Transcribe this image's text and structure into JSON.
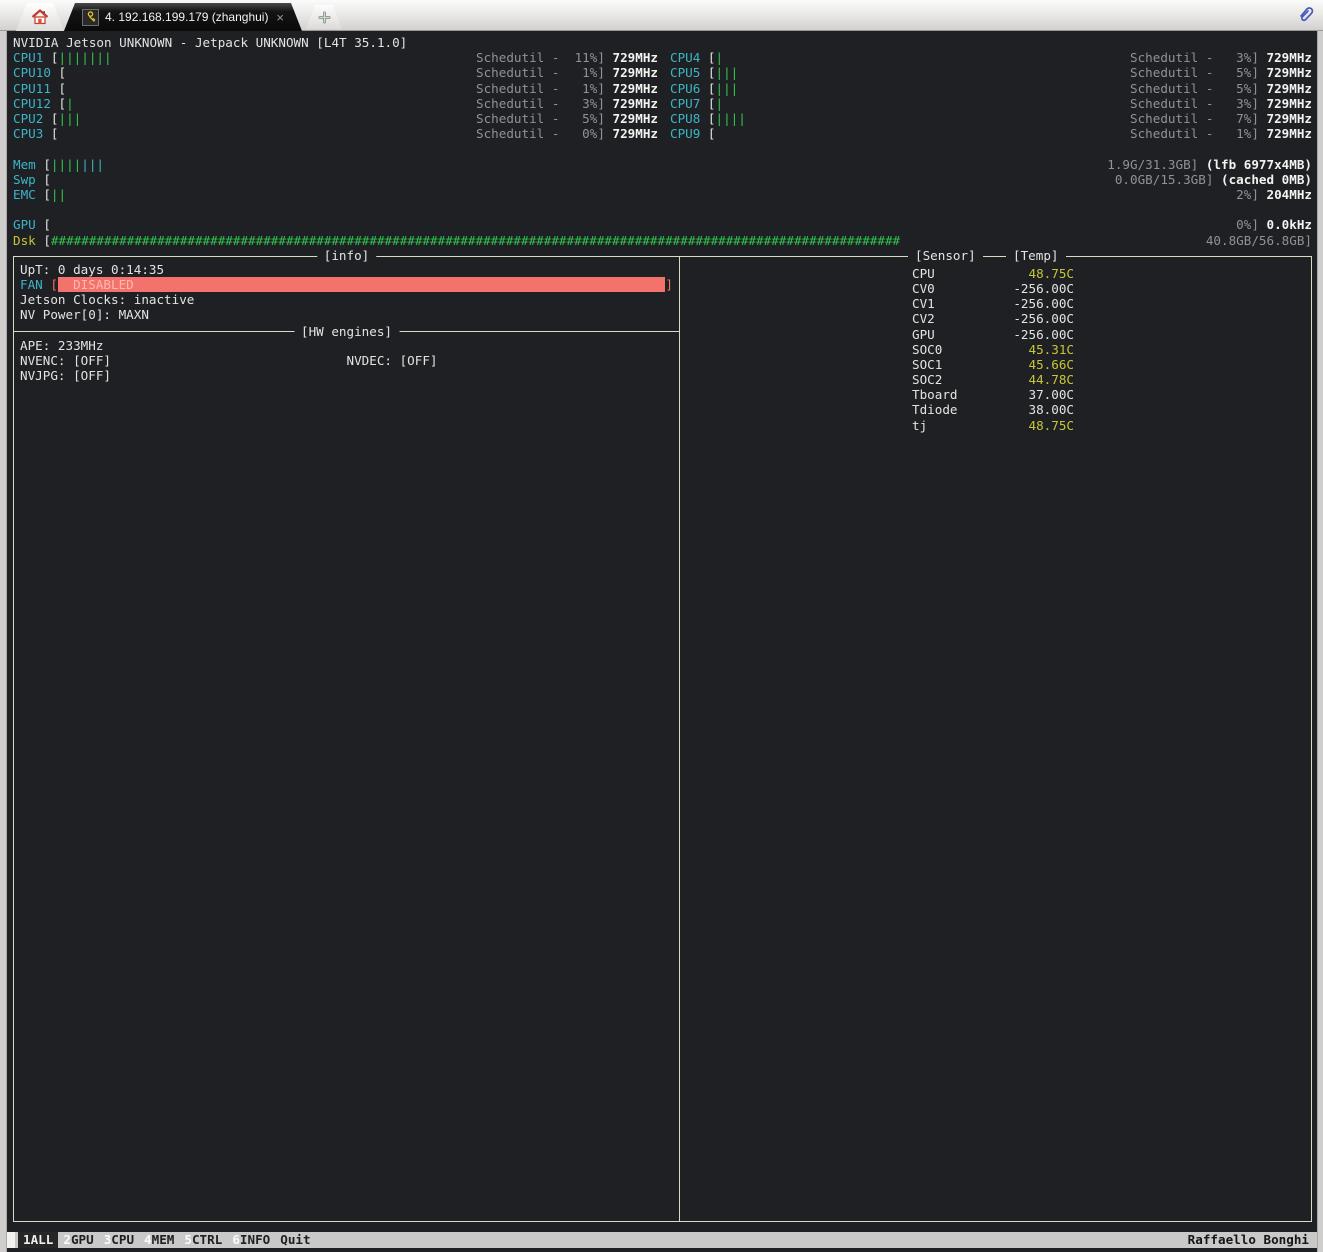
{
  "tab_bar": {
    "home_tab": {
      "icon": "home-icon"
    },
    "session_tab": {
      "icon": "key-icon",
      "title": "4. 192.168.199.179 (zhanghui)",
      "close": "×"
    },
    "new_tab": "+",
    "pin_icon": "paperclip-icon"
  },
  "terminal": {
    "title_line": "NVIDIA Jetson UNKNOWN - Jetpack UNKNOWN [L4T 35.1.0]",
    "cpu_left": [
      {
        "label": "CPU1",
        "bars": 7,
        "governor": "Schedutil",
        "percent": 11,
        "freq": "729MHz"
      },
      {
        "label": "CPU10",
        "bars": 0,
        "governor": "Schedutil",
        "percent": 1,
        "freq": "729MHz"
      },
      {
        "label": "CPU11",
        "bars": 0,
        "governor": "Schedutil",
        "percent": 1,
        "freq": "729MHz"
      },
      {
        "label": "CPU12",
        "bars": 1,
        "governor": "Schedutil",
        "percent": 3,
        "freq": "729MHz"
      },
      {
        "label": "CPU2",
        "bars": 3,
        "governor": "Schedutil",
        "percent": 5,
        "freq": "729MHz"
      },
      {
        "label": "CPU3",
        "bars": 0,
        "governor": "Schedutil",
        "percent": 0,
        "freq": "729MHz"
      }
    ],
    "cpu_right": [
      {
        "label": "CPU4",
        "bars": 1,
        "governor": "Schedutil",
        "percent": 3,
        "freq": "729MHz"
      },
      {
        "label": "CPU5",
        "bars": 3,
        "governor": "Schedutil",
        "percent": 5,
        "freq": "729MHz"
      },
      {
        "label": "CPU6",
        "bars": 3,
        "governor": "Schedutil",
        "percent": 5,
        "freq": "729MHz"
      },
      {
        "label": "CPU7",
        "bars": 1,
        "governor": "Schedutil",
        "percent": 3,
        "freq": "729MHz"
      },
      {
        "label": "CPU8",
        "bars": 4,
        "governor": "Schedutil",
        "percent": 7,
        "freq": "729MHz"
      },
      {
        "label": "CPU9",
        "bars": 0,
        "governor": "Schedutil",
        "percent": 1,
        "freq": "729MHz"
      }
    ],
    "mem_gauges": [
      {
        "label": "Mem",
        "bars_used": 4,
        "bars_cached": 3,
        "right": "1.9G/31.3GB]",
        "extra": "(lfb 6977x4MB)"
      },
      {
        "label": "Swp",
        "bars_used": 0,
        "bars_cached": 0,
        "right": "0.0GB/15.3GB]",
        "extra": "(cached 0MB)"
      },
      {
        "label": "EMC",
        "bars_used": 2,
        "bars_cached": 0,
        "right": "2%]",
        "extra": "204MHz"
      }
    ],
    "gpu_gauge": {
      "label": "GPU",
      "bars_used": 0,
      "bars_cached": 0,
      "right": "0%]",
      "extra": "0.0kHz"
    },
    "disk_gauge": {
      "label": "Dsk",
      "fill_chars": 112,
      "right": "40.8GB/56.8GB]"
    },
    "info_panel": {
      "title": "[info]",
      "uptime": "UpT: 0 days 0:14:35",
      "fan": {
        "label": "FAN",
        "status": "  DISABLED",
        "close": "]"
      },
      "jetson_clocks": "Jetson Clocks: inactive",
      "nv_power": "NV Power[0]: MAXN",
      "hw_title": "[HW engines]",
      "ape": "APE: 233MHz",
      "nvenc": "NVENC: [OFF]",
      "nvdec": "NVDEC: [OFF]",
      "nvjpg": "NVJPG: [OFF]"
    },
    "sensor_panel": {
      "col_sensor": "[Sensor]",
      "col_temp": "[Temp]",
      "sensors": [
        {
          "name": "CPU",
          "temp": "48.75C",
          "hot": true
        },
        {
          "name": "CV0",
          "temp": "-256.00C",
          "hot": false
        },
        {
          "name": "CV1",
          "temp": "-256.00C",
          "hot": false
        },
        {
          "name": "CV2",
          "temp": "-256.00C",
          "hot": false
        },
        {
          "name": "GPU",
          "temp": "-256.00C",
          "hot": false
        },
        {
          "name": "SOC0",
          "temp": "45.31C",
          "hot": true
        },
        {
          "name": "SOC1",
          "temp": "45.66C",
          "hot": true
        },
        {
          "name": "SOC2",
          "temp": "44.78C",
          "hot": true
        },
        {
          "name": "Tboard",
          "temp": "37.00C",
          "hot": false
        },
        {
          "name": "Tdiode",
          "temp": "38.00C",
          "hot": false
        },
        {
          "name": "tj",
          "temp": "48.75C",
          "hot": true
        }
      ]
    },
    "menu_bar": {
      "items": [
        {
          "key": "1",
          "label": "ALL",
          "active": true
        },
        {
          "key": "2",
          "label": "GPU",
          "active": false
        },
        {
          "key": "3",
          "label": "CPU",
          "active": false
        },
        {
          "key": "4",
          "label": "MEM",
          "active": false
        },
        {
          "key": "5",
          "label": "CTRL",
          "active": false
        },
        {
          "key": "6",
          "label": "INFO",
          "active": false
        },
        {
          "key": "",
          "label": "Quit",
          "active": false
        }
      ],
      "author": "Raffaello Bonghi"
    }
  },
  "colors": {
    "terminal_bg": "#1f2023",
    "accent_cyan": "#3cb4c8",
    "bar_green": "#2fc44f",
    "bar_cyan": "#3cb4c8",
    "text_gray": "#8e9396",
    "text_white": "#e3e4e2",
    "accent_yellow": "#c6c735",
    "fan_red": "#f3726b",
    "panel_border": "#d9dac6",
    "menu_bg": "#c9c9c9"
  }
}
